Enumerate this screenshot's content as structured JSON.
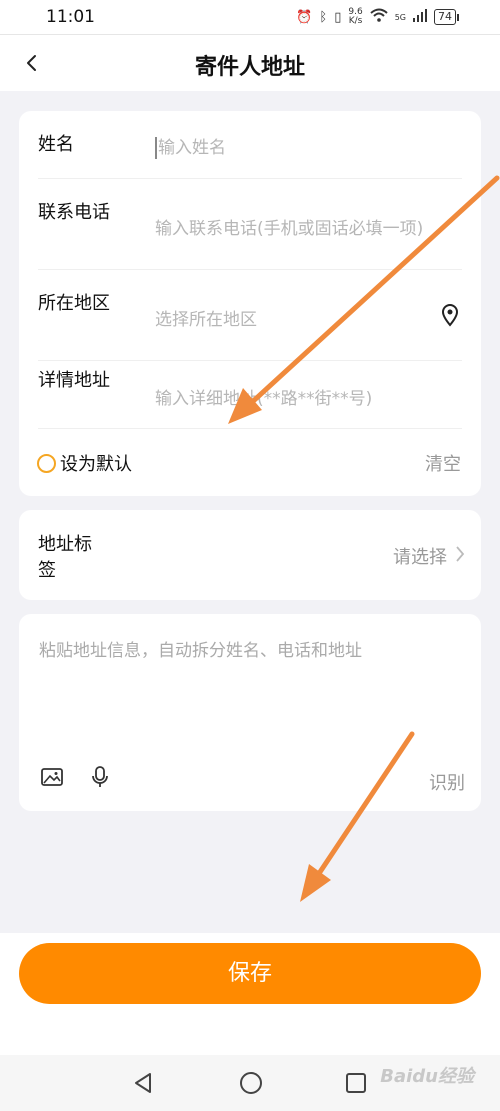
{
  "status_bar": {
    "time": "11:01",
    "speed_value": "9.6",
    "speed_unit": "K/s",
    "network": "5G",
    "battery": "74"
  },
  "header": {
    "title": "寄件人地址"
  },
  "form": {
    "name_label": "姓名",
    "name_placeholder": "输入姓名",
    "phone_label": "联系电话",
    "phone_placeholder": "输入联系电话(手机或固话必填一项)",
    "region_label": "所在地区",
    "region_placeholder": "选择所在地区",
    "detail_label": "详情地址",
    "detail_placeholder": "输入详细地址(**路**街**号)",
    "default_label": "设为默认",
    "clear_label": "清空"
  },
  "tag": {
    "label": "地址标签",
    "select_text": "请选择"
  },
  "paste": {
    "placeholder": "粘贴地址信息，自动拆分姓名、电话和地址",
    "recognize_label": "识别"
  },
  "actions": {
    "save_label": "保存"
  },
  "watermark": "Baidu经验",
  "colors": {
    "accent": "#ff8a00",
    "radio": "#f5a623",
    "annotation_arrow": "#f08a3c"
  }
}
